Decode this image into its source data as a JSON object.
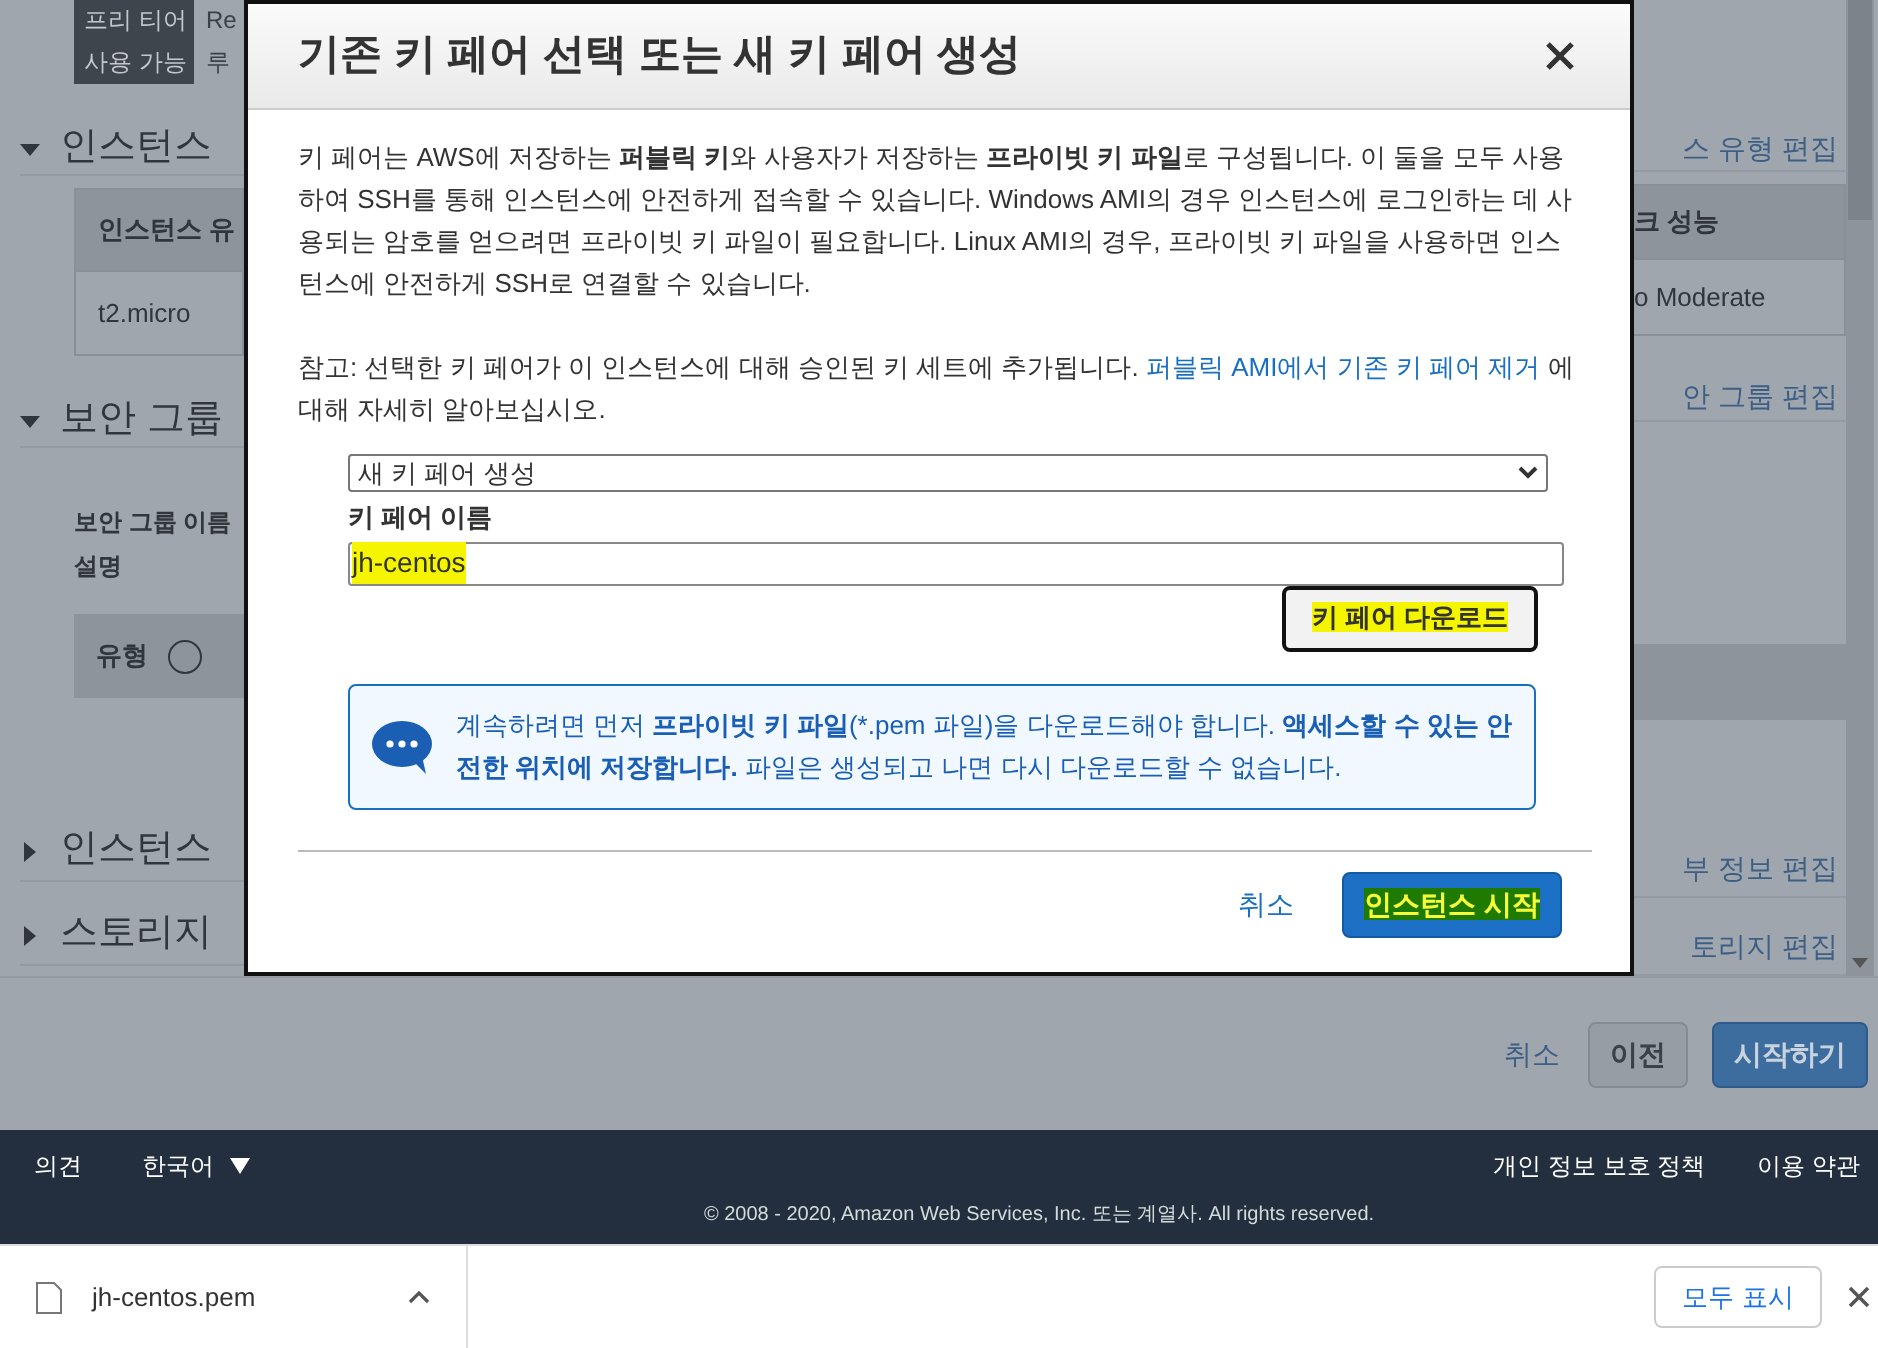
{
  "background": {
    "badge": [
      "프리 티어",
      "사용 가능"
    ],
    "summary_lines": [
      "Re",
      "루"
    ],
    "left": {
      "instance_type_heading": "인스턴스",
      "table_header": "인스턴스 유",
      "table_cell": "t2.micro",
      "security_heading": "보안 그룹",
      "security_name_label": "보안 그룹 이름",
      "description_label": "설명",
      "type_header": "유형",
      "details_heading": "인스턴스",
      "storage_heading": "스토리지"
    },
    "right": {
      "instance_type_edit": "스 유형 편집",
      "table_header": "크 성능",
      "table_cell": "o Moderate",
      "security_edit": "안 그룹 편집",
      "details_edit": "부 정보 편집",
      "storage_edit": "토리지 편집"
    },
    "actions": [
      "취소",
      "이전",
      "시작하기"
    ]
  },
  "modal": {
    "title": "기존 키 페어 선택 또는 새 키 페어 생성",
    "intro": "키 페어는 AWS에 저장하는 **퍼블릭 키**와 사용자가 저장하는 **프라이빗 키 파일**로 구성됩니다. 이 둘을 모두 사용하여 SSH를 통해 인스턴스에 안전하게 접속할 수 있습니다. Windows AMI의 경우 인스턴스에 로그인하는 데 사용되는 암호를 얻으려면 프라이빗 키 파일이 필요합니다. Linux AMI의 경우, 프라이빗 키 파일을 사용하면 인스턴스에 안전하게 SSH로 연결할 수 있습니다.",
    "note": "참고: 선택한 키 페어가 이 인스턴스에 대해 승인된 키 세트에 추가됩니다.",
    "note_link": "퍼블릭 AMI에서 기존 키 페어 제거",
    "note_tail": "에 대해 자세히 알아보십시오.",
    "key_pair_select": "새 키 페어 생성",
    "name_label": "키 페어 이름",
    "name_field": {
      "value": "jh-centos",
      "highlighted": true
    },
    "download_button": {
      "label": "키 페어 다운로드",
      "highlighted": true
    },
    "info": "계속하려면 먼저 **프라이빗 키 파일**(*.pem 파일)을 다운로드해야 합니다. **액세스할 수 있는 안전한 위치에 저장합니다.** 파일은 생성되고 나면 다시 다운로드할 수 없습니다.",
    "cancel": "취소",
    "launch_button": {
      "label": "인스턴스 시작",
      "highlighted": true
    }
  },
  "footer": {
    "feedback": "의견",
    "language": "한국어",
    "privacy": "개인 정보 보호 정책",
    "terms": "이용 약관",
    "copyright": "© 2008 - 2020, Amazon Web Services, Inc. 또는 계열사. All rights reserved."
  },
  "download_bar": {
    "file": "jh-centos.pem",
    "show_all": "모두 표시"
  }
}
